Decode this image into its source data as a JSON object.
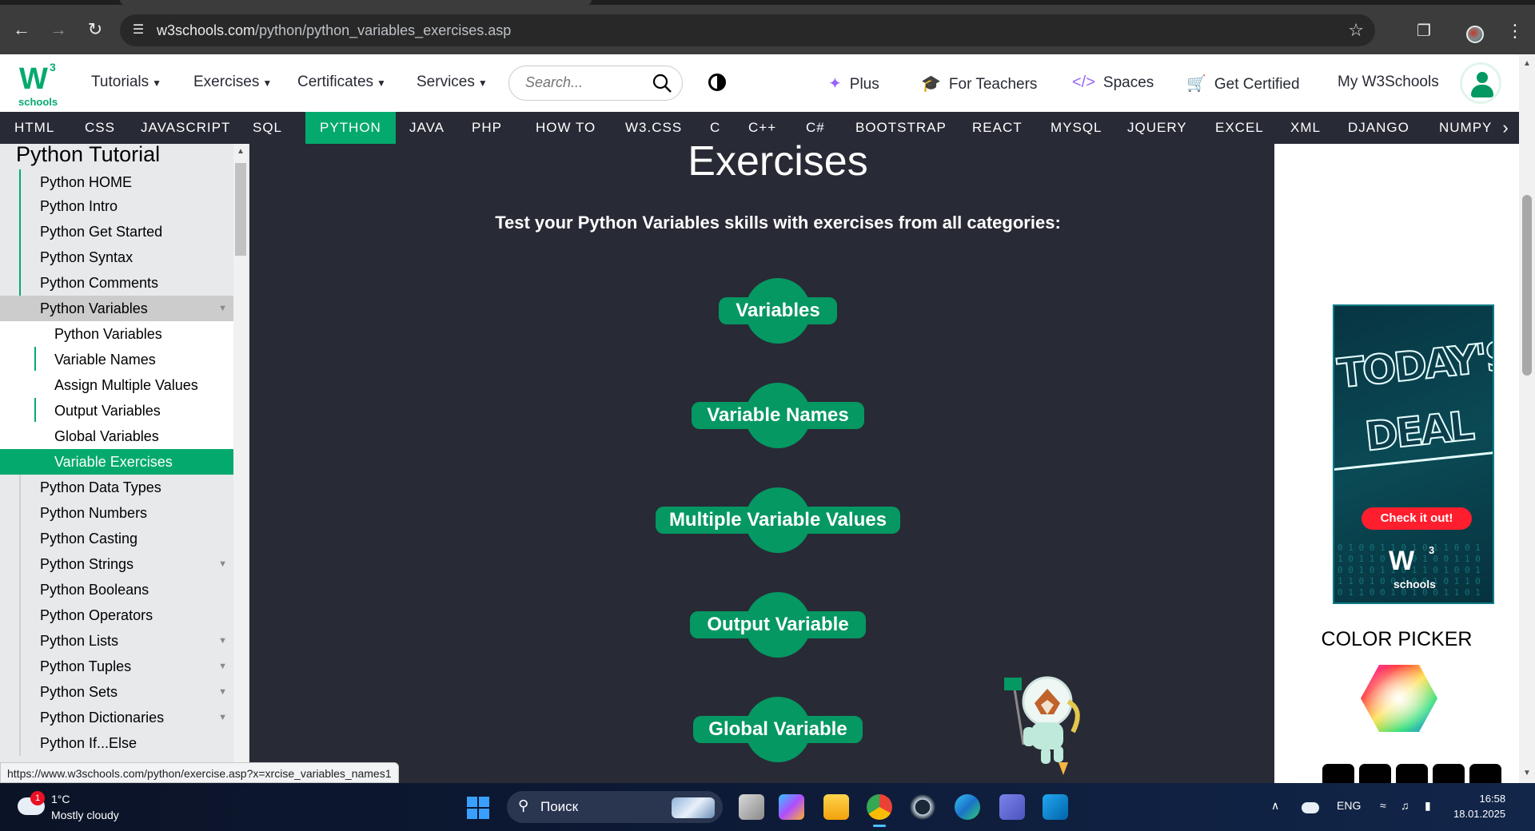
{
  "browser": {
    "url_host": "w3schools.com",
    "url_path": "/python/python_variables_exercises.asp",
    "status_url": "https://www.w3schools.com/python/exercise.asp?x=xrcise_variables_names1"
  },
  "topnav": {
    "logo_text": "W",
    "logo_sup": "3",
    "logo_sub": "schools",
    "tutorials": "Tutorials",
    "exercises": "Exercises",
    "certificates": "Certificates",
    "services": "Services",
    "search_placeholder": "Search...",
    "plus": "Plus",
    "for_teachers": "For Teachers",
    "spaces": "Spaces",
    "get_certified": "Get Certified",
    "my_w3schools": "My W3Schools"
  },
  "subnav": [
    "HTML",
    "CSS",
    "JAVASCRIPT",
    "SQL",
    "PYTHON",
    "JAVA",
    "PHP",
    "HOW TO",
    "W3.CSS",
    "C",
    "C++",
    "C#",
    "BOOTSTRAP",
    "REACT",
    "MYSQL",
    "JQUERY",
    "EXCEL",
    "XML",
    "DJANGO",
    "NUMPY"
  ],
  "subnav_active": "PYTHON",
  "sidebar": {
    "title": "Python Tutorial",
    "items": [
      {
        "label": "Python HOME"
      },
      {
        "label": "Python Intro"
      },
      {
        "label": "Python Get Started"
      },
      {
        "label": "Python Syntax"
      },
      {
        "label": "Python Comments"
      },
      {
        "label": "Python Variables"
      },
      {
        "label": "Python Variables"
      },
      {
        "label": "Variable Names"
      },
      {
        "label": "Assign Multiple Values"
      },
      {
        "label": "Output Variables"
      },
      {
        "label": "Global Variables"
      },
      {
        "label": "Variable Exercises"
      },
      {
        "label": "Python Data Types"
      },
      {
        "label": "Python Numbers"
      },
      {
        "label": "Python Casting"
      },
      {
        "label": "Python Strings"
      },
      {
        "label": "Python Booleans"
      },
      {
        "label": "Python Operators"
      },
      {
        "label": "Python Lists"
      },
      {
        "label": "Python Tuples"
      },
      {
        "label": "Python Sets"
      },
      {
        "label": "Python Dictionaries"
      },
      {
        "label": "Python If...Else"
      }
    ]
  },
  "main": {
    "heading": "Exercises",
    "subheading": "Test your Python Variables skills with exercises from all categories:",
    "categories": [
      "Variables",
      "Variable Names",
      "Multiple Variable Values",
      "Output Variable",
      "Global Variable"
    ]
  },
  "rightcol": {
    "ad_headline": "TODAY'S DEAL",
    "ad_cta": "Check it out!",
    "ad_logo": "W",
    "ad_logo_sup": "3",
    "ad_logo_sub": "schools",
    "color_picker_title": "COLOR PICKER"
  },
  "taskbar": {
    "weather_badge": "1",
    "temperature": "1°C",
    "weather_desc": "Mostly cloudy",
    "search_placeholder": "Поиск",
    "lang": "ENG",
    "time": "16:58",
    "date": "18.01.2025"
  },
  "colors": {
    "accent": "#04AA6D",
    "dark": "#282A35",
    "sidebar_bg": "#E7E9EB"
  }
}
